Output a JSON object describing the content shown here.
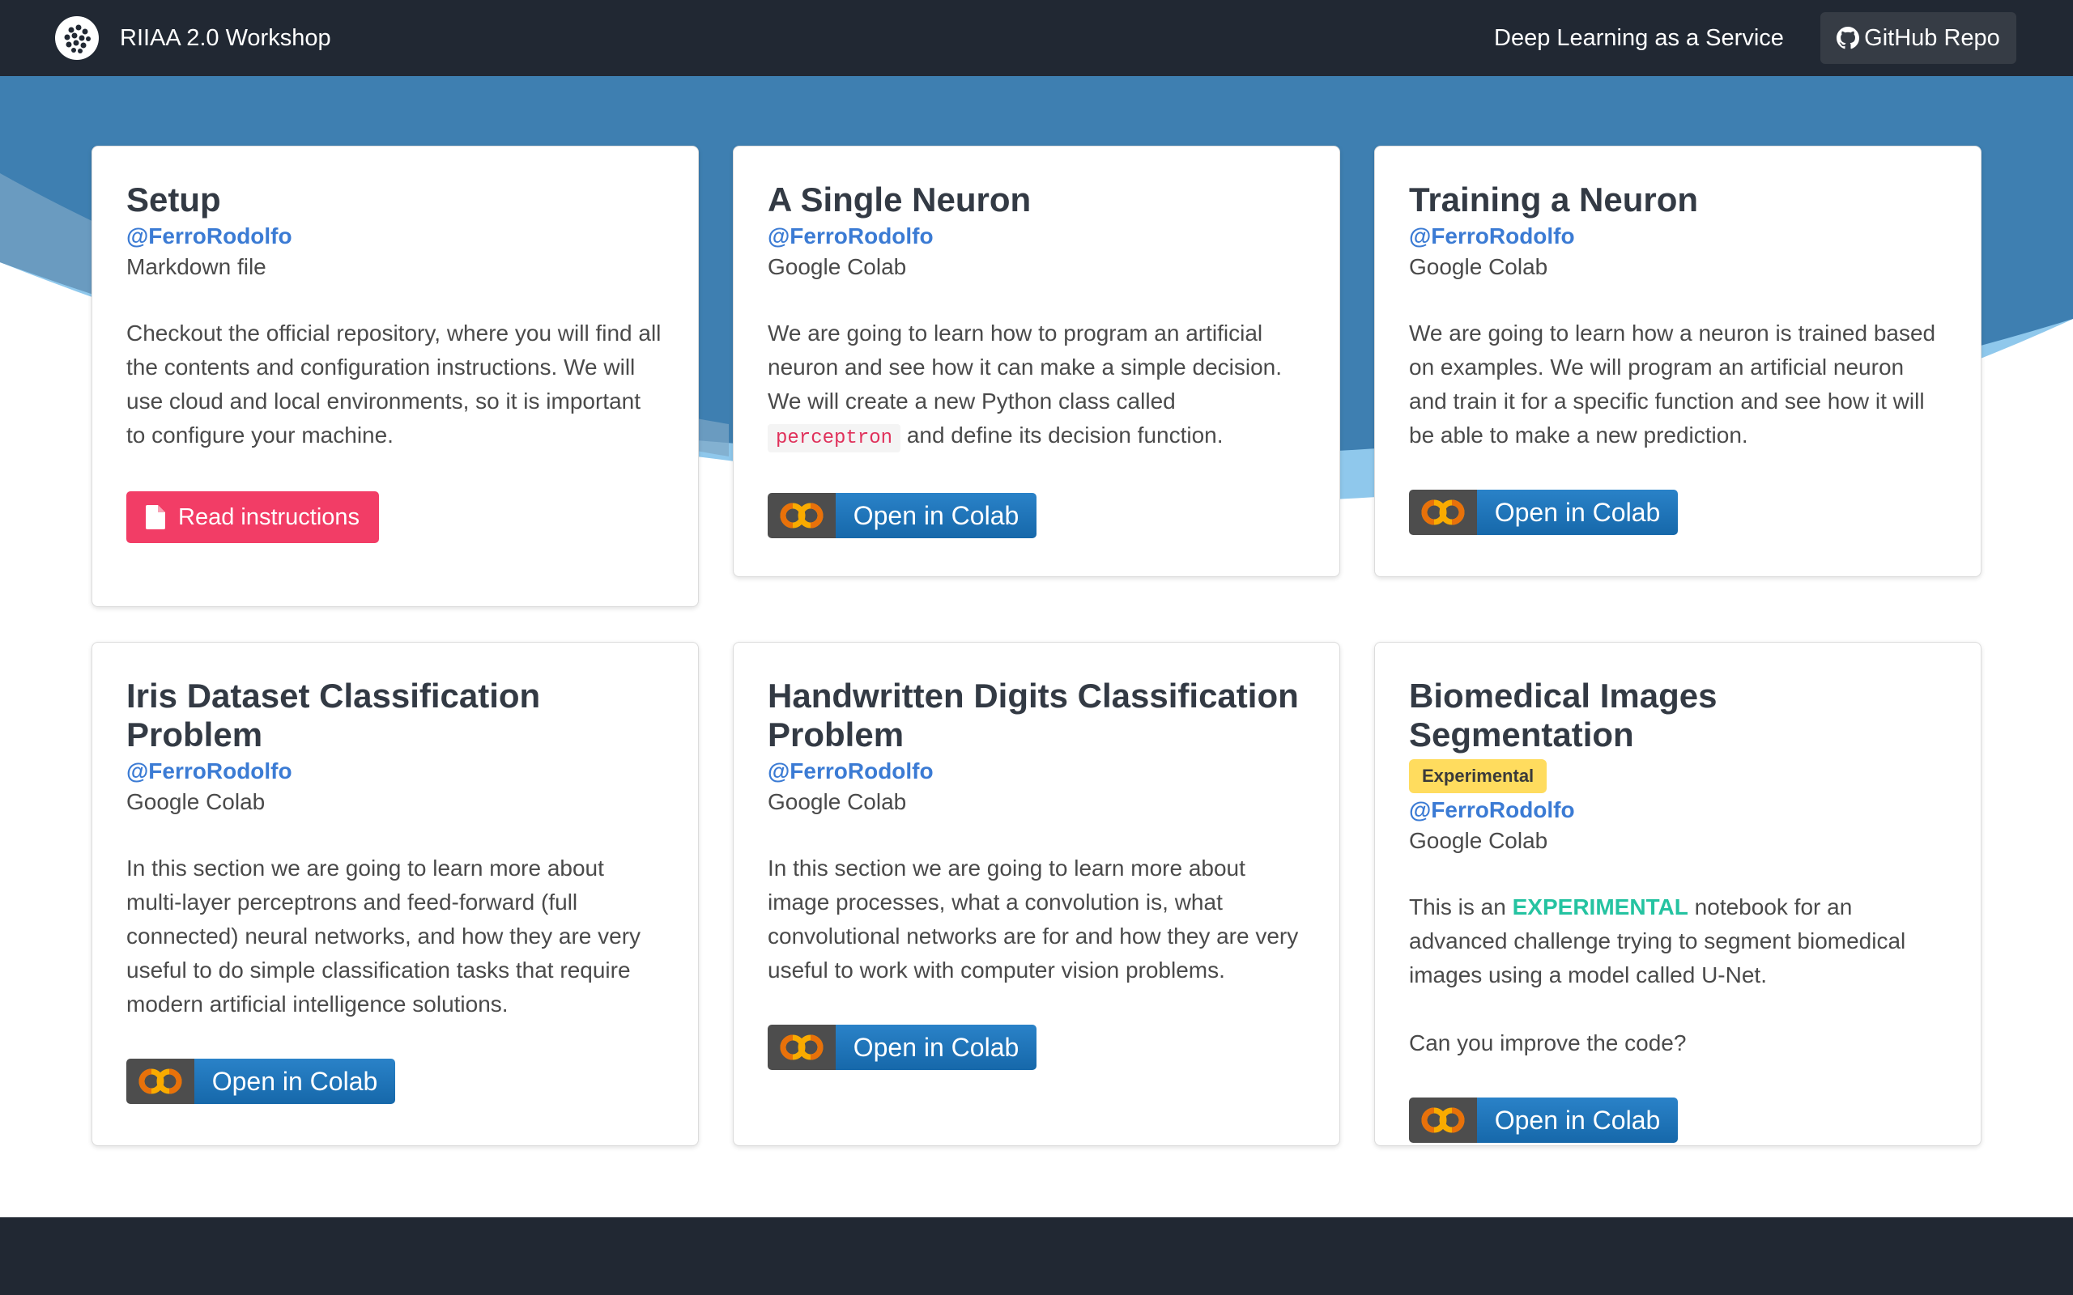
{
  "navbar": {
    "brand_title": "RIIAA 2.0 Workshop",
    "nav_link": "Deep Learning as a Service",
    "github_button": "GitHub Repo"
  },
  "cards": [
    {
      "title": "Setup",
      "author": "@FerroRodolfo",
      "type": "Markdown file",
      "description": "Checkout the official repository, where you will find all the contents and configuration instructions. We will use cloud and local environments, so it is important to configure your machine.",
      "button_label": "Read instructions"
    },
    {
      "title": "A Single Neuron",
      "author": "@FerroRodolfo",
      "type": "Google Colab",
      "description_before": "We are going to learn how to program an artificial neuron and see how it can make a simple decision. We will create a new Python class called",
      "code": "perceptron",
      "description_after": "and define its decision function.",
      "button_label": "Open in Colab"
    },
    {
      "title": "Training a Neuron",
      "author": "@FerroRodolfo",
      "type": "Google Colab",
      "description": "We are going to learn how a neuron is trained based on examples. We will program an artificial neuron and train it for a specific function and see how it will be able to make a new prediction.",
      "button_label": "Open in Colab"
    },
    {
      "title": "Iris Dataset Classification Problem",
      "author": "@FerroRodolfo",
      "type": "Google Colab",
      "description": "In this section we are going to learn more about multi-layer perceptrons and feed-forward (full connected) neural networks, and how they are very useful to do simple classification tasks that require modern artificial intelligence solutions.",
      "button_label": "Open in Colab"
    },
    {
      "title": "Handwritten Digits Classification Problem",
      "author": "@FerroRodolfo",
      "type": "Google Colab",
      "description": "In this section we are going to learn more about image processes, what a convolution is, what convolutional networks are for and how they are very useful to work with computer vision problems.",
      "button_label": "Open in Colab"
    },
    {
      "title": "Biomedical Images Segmentation",
      "badge": "Experimental",
      "author": "@FerroRodolfo",
      "type": "Google Colab",
      "description_before": "This is an",
      "highlight": "EXPERIMENTAL",
      "description_after": "notebook for an advanced challenge trying to segment biomedical images using a model called U-Net.",
      "question": "Can you improve the code?",
      "button_label": "Open in Colab"
    }
  ],
  "colors": {
    "navbar_bg": "#212833",
    "hero_blue": "#3e7fb1",
    "hero_light": "#8fc8ec",
    "link_blue": "#3b7bd4",
    "read_button": "#f23d66",
    "experimental_badge": "#ffdc5e",
    "experimental_text": "#25c3a1"
  },
  "icons": {
    "brand": "dots-logo-icon",
    "github": "github-icon",
    "file": "file-icon",
    "colab": "colab-logo-icon"
  }
}
